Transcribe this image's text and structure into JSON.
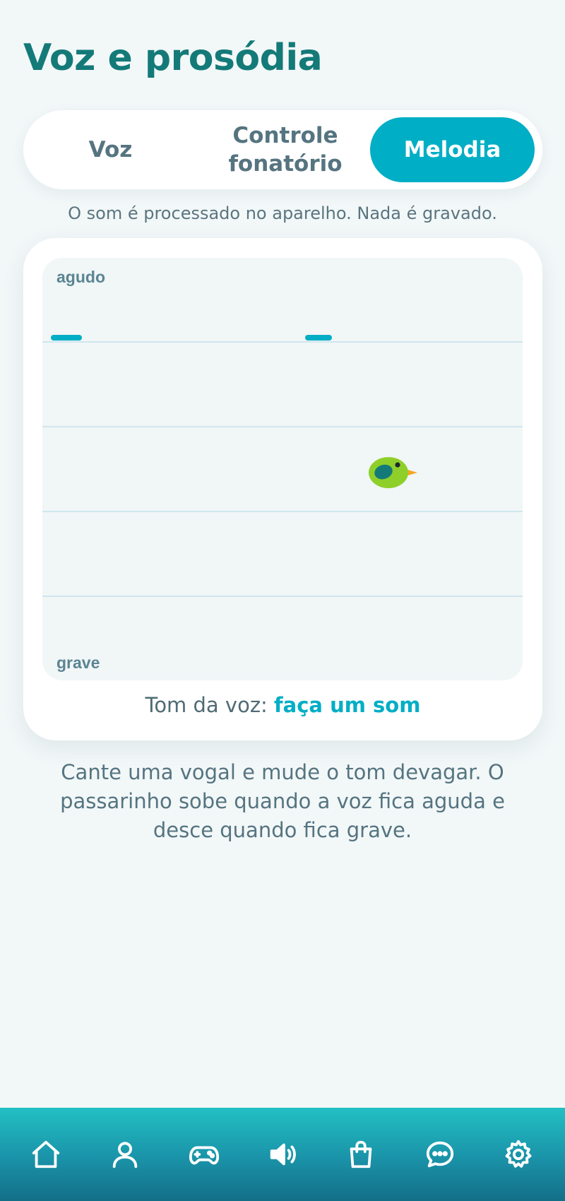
{
  "header": {
    "title": "Voz e prosódia"
  },
  "tabs": [
    {
      "label": "Voz",
      "active": false
    },
    {
      "label": "Controle fonatório",
      "active": false
    },
    {
      "label": "Melodia",
      "active": true
    }
  ],
  "privacy_note": "O som é processado no aparelho. Nada é gravado.",
  "pitch_panel": {
    "high_label": "agudo",
    "low_label": "grave",
    "tone_label": "Tom da voz:",
    "tone_value": "faça um som"
  },
  "instructions": "Cante uma vogal e mude o tom devagar. O passarinho sobe quando a voz fica aguda e desce quando fica grave.",
  "bottom_nav": [
    {
      "icon": "home-icon"
    },
    {
      "icon": "profile-icon"
    },
    {
      "icon": "gamepad-icon"
    },
    {
      "icon": "speaker-icon"
    },
    {
      "icon": "shopping-bag-icon"
    },
    {
      "icon": "chat-icon"
    },
    {
      "icon": "settings-icon"
    }
  ],
  "colors": {
    "accent": "#00aec6",
    "title": "#137a78",
    "background": "#f2f7f8",
    "bird_body": "#8fcf2a",
    "bird_wing": "#137a78",
    "bird_beak": "#f5a623"
  }
}
